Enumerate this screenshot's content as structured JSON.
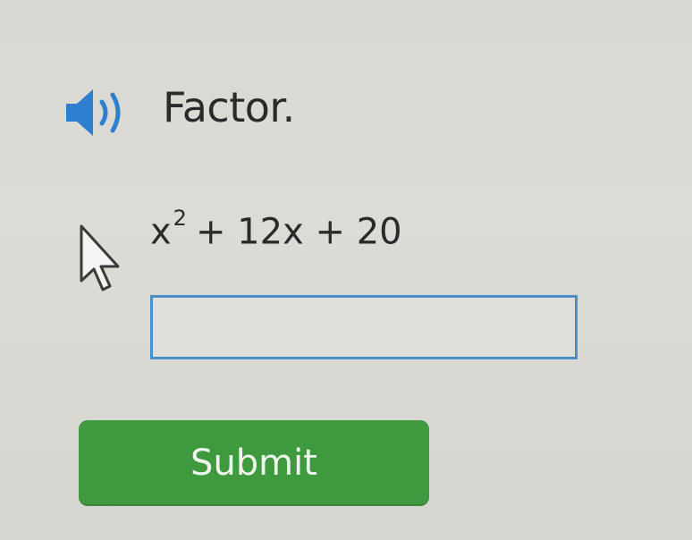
{
  "question": {
    "instruction": "Factor.",
    "speaker_icon": "speaker-icon",
    "expression": {
      "variable": "x",
      "exponent": "2",
      "rest": "+ 12x + 20"
    }
  },
  "answer": {
    "value": "",
    "placeholder": ""
  },
  "submit_label": "Submit",
  "colors": {
    "input_border": "#4d8fc4",
    "submit_background": "#3f9a3f",
    "speaker_blue": "#2f7fd0"
  }
}
